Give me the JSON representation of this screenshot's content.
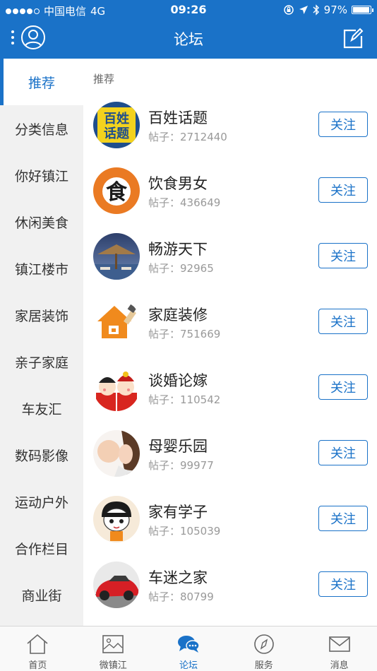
{
  "status_bar": {
    "carrier": "中国电信",
    "network": "4G",
    "time": "09:26",
    "battery": "97%",
    "battery_level": 0.97
  },
  "nav": {
    "title": "论坛",
    "user_icon": "user-circle-icon",
    "edit_icon": "edit-icon"
  },
  "sidebar": {
    "items": [
      {
        "label": "推荐",
        "active": true
      },
      {
        "label": "分类信息"
      },
      {
        "label": "你好镇江"
      },
      {
        "label": "休闲美食"
      },
      {
        "label": "镇江楼市"
      },
      {
        "label": "家居装饰"
      },
      {
        "label": "亲子家庭"
      },
      {
        "label": "车友汇"
      },
      {
        "label": "数码影像"
      },
      {
        "label": "运动户外"
      },
      {
        "label": "合作栏目"
      },
      {
        "label": "商业街"
      }
    ]
  },
  "content": {
    "section_title": "推荐",
    "follow_label": "关注",
    "posts_prefix": "帖子：",
    "forums": [
      {
        "name": "百姓话题",
        "posts": "2712440",
        "logo_text": [
          "百姓",
          "话题"
        ]
      },
      {
        "name": "饮食男女",
        "posts": "436649",
        "logo_text": "食"
      },
      {
        "name": "畅游天下",
        "posts": "92965"
      },
      {
        "name": "家庭装修",
        "posts": "751669"
      },
      {
        "name": "谈婚论嫁",
        "posts": "110542"
      },
      {
        "name": "母婴乐园",
        "posts": "99977"
      },
      {
        "name": "家有学子",
        "posts": "105039"
      },
      {
        "name": "车迷之家",
        "posts": "80799"
      }
    ]
  },
  "tabbar": {
    "tabs": [
      {
        "label": "首页",
        "icon": "home-icon"
      },
      {
        "label": "微镇江",
        "icon": "image-icon"
      },
      {
        "label": "论坛",
        "icon": "chat-bubbles-icon",
        "active": true
      },
      {
        "label": "服务",
        "icon": "compass-icon"
      },
      {
        "label": "消息",
        "icon": "mail-icon"
      }
    ]
  },
  "colors": {
    "primary": "#1a72c8",
    "sidebar_bg": "#f1f1f1"
  }
}
